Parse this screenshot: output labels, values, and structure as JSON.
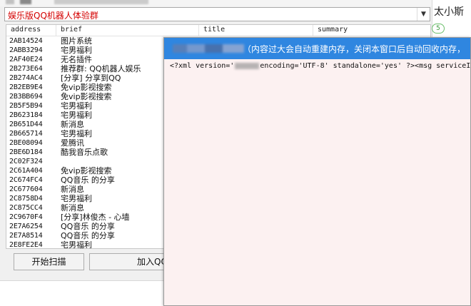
{
  "window": {
    "group_select": {
      "value": "娱乐版QQ机器人体验群"
    }
  },
  "table": {
    "columns": [
      "address",
      "brief",
      "title",
      "summary"
    ],
    "rows": [
      {
        "address": "2AB14524",
        "brief": "图片系统"
      },
      {
        "address": "2ABB3294",
        "brief": "宅男福利"
      },
      {
        "address": "2AF40E24",
        "brief": "无名插件"
      },
      {
        "address": "2B273E64",
        "brief": "推荐群: QQ机器人娱乐"
      },
      {
        "address": "2B274AC4",
        "brief": "[分享] 分享到QQ"
      },
      {
        "address": "2B2EB9E4",
        "brief": "免vip影视搜索"
      },
      {
        "address": "2B3BB694",
        "brief": "免vip影视搜索"
      },
      {
        "address": "2B5F5B94",
        "brief": "宅男福利"
      },
      {
        "address": "2B623184",
        "brief": "宅男福利"
      },
      {
        "address": "2B651D44",
        "brief": "新消息"
      },
      {
        "address": "2B665714",
        "brief": "宅男福利"
      },
      {
        "address": "2BE08094",
        "brief": "爱腾讯"
      },
      {
        "address": "2BE6D184",
        "brief": "酷我音乐点歌"
      },
      {
        "address": "2C02F324",
        "brief": ""
      },
      {
        "address": "2C61A404",
        "brief": "免vip影视搜索"
      },
      {
        "address": "2C674FC4",
        "brief": "QQ音乐 的分享"
      },
      {
        "address": "2C677604",
        "brief": "新消息"
      },
      {
        "address": "2C8758D4",
        "brief": "宅男福利"
      },
      {
        "address": "2C875CC4",
        "brief": "新消息"
      },
      {
        "address": "2C9670F4",
        "brief": "[分享]林俊杰 - 心墙"
      },
      {
        "address": "2E7A6254",
        "brief": "QQ音乐 的分享"
      },
      {
        "address": "2E7A8514",
        "brief": "QQ音乐 的分享"
      },
      {
        "address": "2E8FE2E4",
        "brief": "宅男福利"
      }
    ]
  },
  "buttons": {
    "scan": "开始扫描",
    "join": "加入QQ"
  },
  "right_panel": {
    "text": "太小斯",
    "badge": "5"
  },
  "popup": {
    "title": "（内容过大会自动重建内存，关闭本窗口后自动回收内存，",
    "content_prefix": "<?xml version='",
    "content_mid": "encoding='UTF-8' standalone='yes' ?>",
    "content_suffix": "<msg serviceID="
  }
}
